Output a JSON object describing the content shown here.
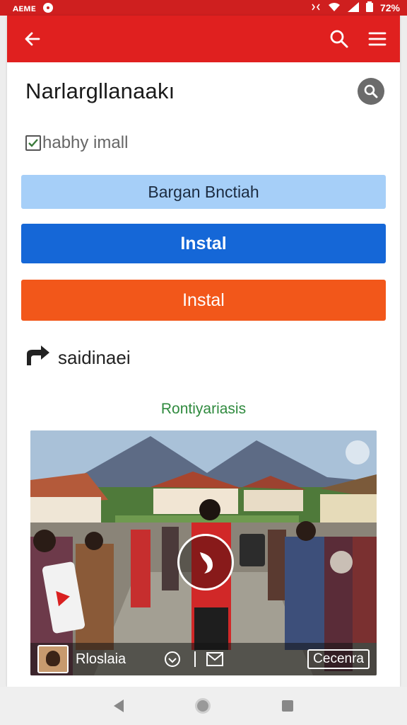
{
  "status_bar": {
    "left_text": "ᴀᴇᴍᴇ",
    "right_text": "72%",
    "icons": [
      "record-icon",
      "vibrate-icon",
      "wifi-icon",
      "signal-icon",
      "battery-icon"
    ]
  },
  "app_bar": {
    "color": "#e0201f",
    "icons": [
      "back-arrow-icon",
      "search-icon",
      "menu-icon"
    ]
  },
  "page": {
    "title": "Narlargllanaakı",
    "checkbox_label": "habhy imall",
    "buttons": {
      "light": "Bargan Bnctiah",
      "blue": "Instal",
      "orange": "Instal"
    },
    "section_label": "saidinaei",
    "section_sub": "Rontiyariasis"
  },
  "media": {
    "channel_name": "Rloslaia",
    "action_button": "Cecenra",
    "icons": [
      "play-icon",
      "heart-icon",
      "mail-icon",
      "avatar"
    ]
  },
  "colors": {
    "status": "#cf1f1f",
    "blue": "#1567d7",
    "orange": "#f2571a",
    "light": "#a6cff8",
    "green_text": "#2f8a3e"
  }
}
